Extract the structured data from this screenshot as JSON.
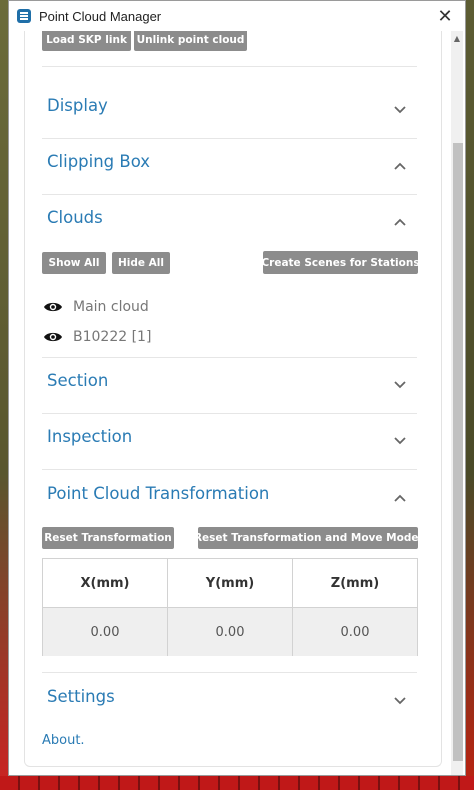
{
  "window": {
    "title": "Point Cloud Manager",
    "close_symbol": "✕"
  },
  "top_buttons": {
    "load": "Load SKP link",
    "unlink": "Unlink point cloud"
  },
  "sections": {
    "display": {
      "title": "Display",
      "expanded": false
    },
    "clipping": {
      "title": "Clipping Box",
      "expanded": true
    },
    "clouds": {
      "title": "Clouds",
      "expanded": true
    },
    "section": {
      "title": "Section",
      "expanded": false
    },
    "inspection": {
      "title": "Inspection",
      "expanded": false
    },
    "transformation": {
      "title": "Point Cloud Transformation",
      "expanded": true
    },
    "settings": {
      "title": "Settings",
      "expanded": false
    }
  },
  "clouds": {
    "show_all": "Show All",
    "hide_all": "Hide All",
    "create_scenes": "Create Scenes for Stations",
    "items": [
      {
        "name": "Main cloud",
        "icon": "eye-icon"
      },
      {
        "name": "B10222 [1]",
        "icon": "eye-icon"
      }
    ]
  },
  "transformation": {
    "reset": "Reset Transformation",
    "reset_move": "Reset Transformation and Move Model",
    "headers": [
      "X(mm)",
      "Y(mm)",
      "Z(mm)"
    ],
    "values": [
      "0.00",
      "0.00",
      "0.00"
    ]
  },
  "footer": {
    "about": "About."
  },
  "colors": {
    "accent": "#2a7bb4",
    "button": "#8c8c8c"
  }
}
